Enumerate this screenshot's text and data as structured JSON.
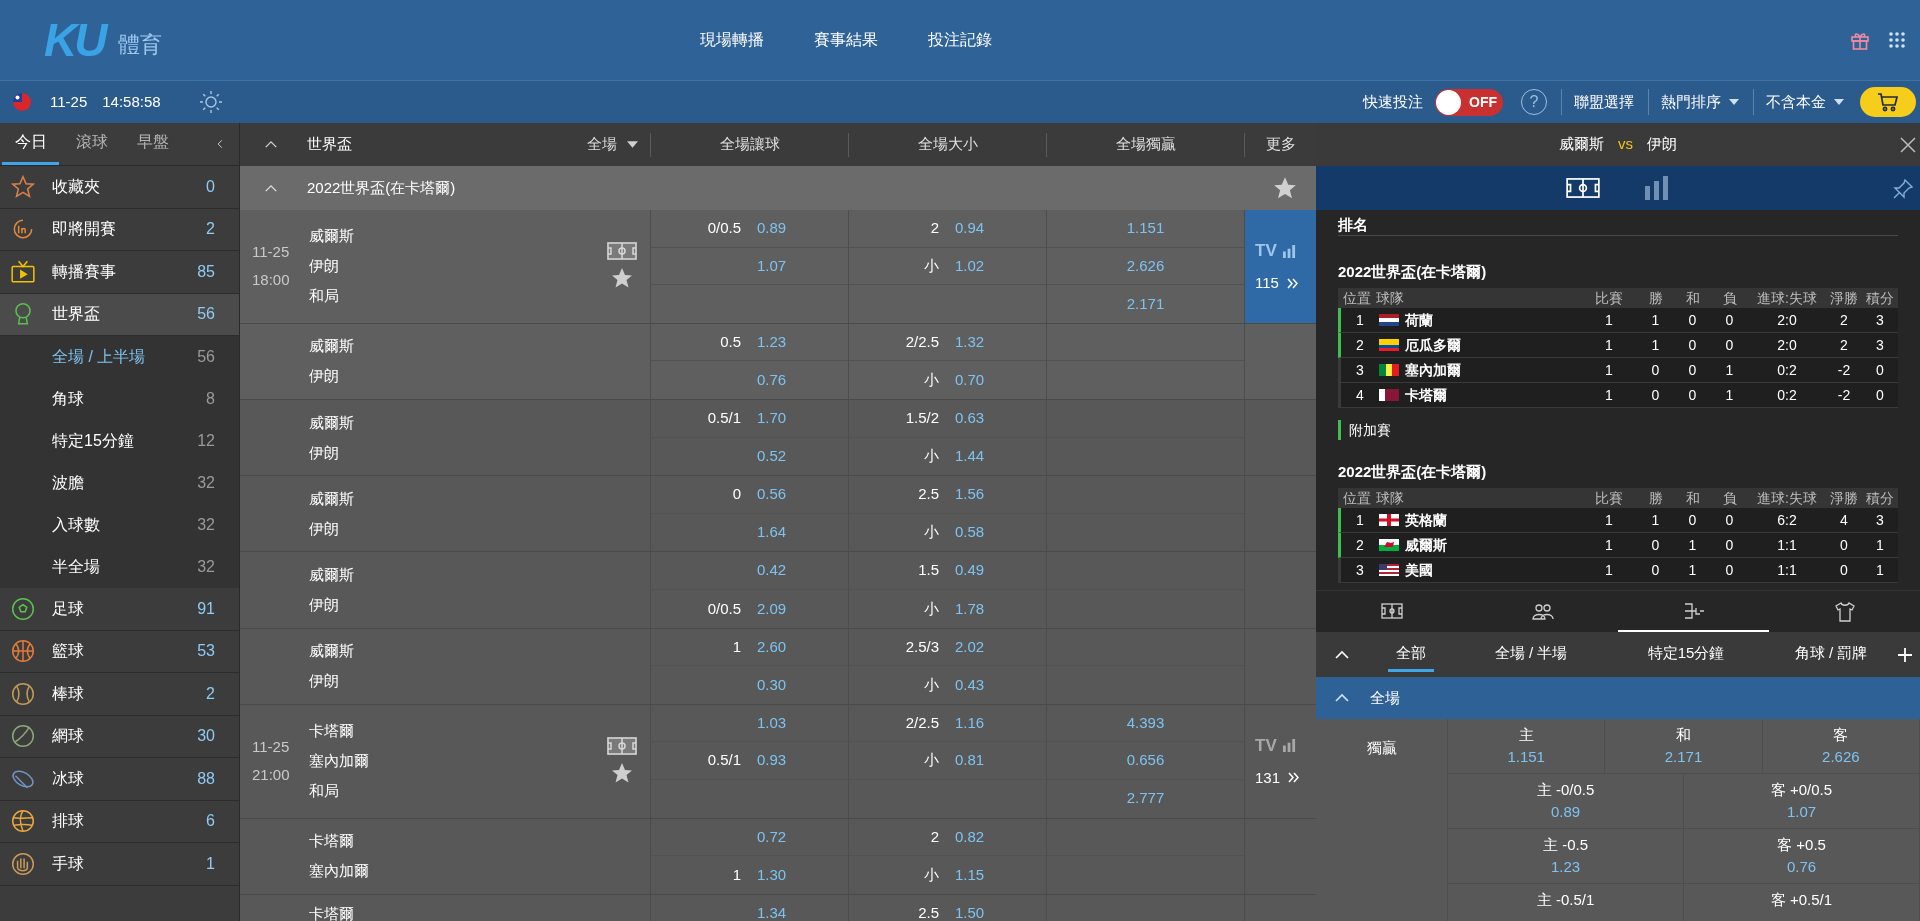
{
  "header": {
    "logo": {
      "mark": "KU",
      "text": "體育"
    },
    "nav": [
      {
        "label": "現場轉播"
      },
      {
        "label": "賽事結果"
      },
      {
        "label": "投注記錄"
      }
    ]
  },
  "subbar": {
    "date": "11-25",
    "time": "14:58:58",
    "quick_bet": {
      "label": "快速投注",
      "on": false,
      "toggle_text": "OFF"
    },
    "help": "?",
    "menus": [
      {
        "label": "聯盟選擇",
        "dropdown": false
      },
      {
        "label": "熱門排序",
        "dropdown": true
      },
      {
        "label": "不含本金",
        "dropdown": true
      }
    ]
  },
  "sidebar": {
    "tabs": [
      {
        "label": "今日",
        "selected": true
      },
      {
        "label": "滾球",
        "selected": false
      },
      {
        "label": "早盤",
        "selected": false
      }
    ],
    "items": [
      {
        "kind": "star",
        "label": "收藏夾",
        "count": "0",
        "expanded": false
      },
      {
        "kind": "soon",
        "label": "即將開賽",
        "count": "2",
        "expanded": false
      },
      {
        "kind": "tv",
        "label": "轉播賽事",
        "count": "85",
        "expanded": false
      },
      {
        "kind": "trophy",
        "label": "世界盃",
        "count": "56",
        "expanded": true,
        "children": [
          {
            "label": "全場 / 上半場",
            "count": "56",
            "selected": true
          },
          {
            "label": "角球",
            "count": "8",
            "selected": false
          },
          {
            "label": "特定15分鐘",
            "count": "12",
            "selected": false
          },
          {
            "label": "波膽",
            "count": "32",
            "selected": false
          },
          {
            "label": "入球數",
            "count": "32",
            "selected": false
          },
          {
            "label": "半全場",
            "count": "32",
            "selected": false
          }
        ]
      },
      {
        "kind": "soccer",
        "label": "足球",
        "count": "91",
        "expanded": false
      },
      {
        "kind": "basketball",
        "label": "籃球",
        "count": "53",
        "expanded": false
      },
      {
        "kind": "baseball",
        "label": "棒球",
        "count": "2",
        "expanded": false
      },
      {
        "kind": "tennis",
        "label": "網球",
        "count": "30",
        "expanded": false
      },
      {
        "kind": "hockey",
        "label": "冰球",
        "count": "88",
        "expanded": false
      },
      {
        "kind": "volleyball",
        "label": "排球",
        "count": "6",
        "expanded": false
      },
      {
        "kind": "handball",
        "label": "手球",
        "count": "1",
        "expanded": false
      }
    ]
  },
  "market": {
    "sport": "世界盃",
    "period": "全場",
    "columns": [
      "全場讓球",
      "全場大小",
      "全場獨贏",
      "更多"
    ],
    "league": {
      "name": "2022世界盃(在卡塔爾)",
      "expanded": true
    },
    "matches": [
      {
        "date": "11-25",
        "time": "18:00",
        "favorite": false,
        "teams": [
          "威爾斯",
          "伊朗",
          "和局"
        ],
        "lines": [
          {
            "hdp": "0/0.5",
            "hdp_odds": "0.89",
            "ou": "2",
            "ou_odds": "0.94",
            "win": "1.151"
          },
          {
            "hdp_odds": "1.07",
            "ou": "小",
            "ou_odds": "1.02",
            "win": "2.626"
          },
          {
            "win": "2.171"
          }
        ],
        "more": {
          "tv": "TV",
          "count": "115",
          "selected": true
        }
      },
      {
        "teams": [
          "威爾斯",
          "伊朗"
        ],
        "lines": [
          {
            "hdp": "0.5",
            "hdp_odds": "1.23",
            "ou": "2/2.5",
            "ou_odds": "1.32"
          },
          {
            "hdp_odds": "0.76",
            "ou": "小",
            "ou_odds": "0.70"
          }
        ]
      },
      {
        "teams": [
          "威爾斯",
          "伊朗"
        ],
        "lines": [
          {
            "hdp": "0.5/1",
            "hdp_odds": "1.70",
            "ou": "1.5/2",
            "ou_odds": "0.63"
          },
          {
            "hdp_odds": "0.52",
            "ou": "小",
            "ou_odds": "1.44"
          }
        ]
      },
      {
        "teams": [
          "威爾斯",
          "伊朗"
        ],
        "lines": [
          {
            "hdp": "0",
            "hdp_odds": "0.56",
            "ou": "2.5",
            "ou_odds": "1.56"
          },
          {
            "hdp_odds": "1.64",
            "ou": "小",
            "ou_odds": "0.58"
          }
        ]
      },
      {
        "teams": [
          "威爾斯",
          "伊朗"
        ],
        "lines": [
          {
            "hdp_odds": "0.42",
            "ou": "1.5",
            "ou_odds": "0.49"
          },
          {
            "hdp": "0/0.5",
            "hdp_odds": "2.09",
            "ou": "小",
            "ou_odds": "1.78"
          }
        ]
      },
      {
        "teams": [
          "威爾斯",
          "伊朗"
        ],
        "lines": [
          {
            "hdp": "1",
            "hdp_odds": "2.60",
            "ou": "2.5/3",
            "ou_odds": "2.02"
          },
          {
            "hdp_odds": "0.30",
            "ou": "小",
            "ou_odds": "0.43"
          }
        ]
      },
      {
        "date": "11-25",
        "time": "21:00",
        "favorite": false,
        "teams": [
          "卡塔爾",
          "塞內加爾",
          "和局"
        ],
        "lines": [
          {
            "hdp_odds": "1.03",
            "ou": "2/2.5",
            "ou_odds": "1.16",
            "win": "4.393"
          },
          {
            "hdp": "0.5/1",
            "hdp_odds": "0.93",
            "ou": "小",
            "ou_odds": "0.81",
            "win": "0.656"
          },
          {
            "win": "2.777"
          }
        ],
        "more": {
          "tv": "TV",
          "count": "131",
          "selected": false
        }
      },
      {
        "teams": [
          "卡塔爾",
          "塞內加爾"
        ],
        "lines": [
          {
            "hdp_odds": "0.72",
            "ou": "2",
            "ou_odds": "0.82"
          },
          {
            "hdp": "1",
            "hdp_odds": "1.30",
            "ou": "小",
            "ou_odds": "1.15"
          }
        ]
      },
      {
        "teams": [
          "卡塔爾"
        ],
        "lines": [
          {
            "hdp_odds": "1.34",
            "ou": "2.5",
            "ou_odds": "1.50"
          }
        ]
      }
    ]
  },
  "detail": {
    "home": "威爾斯",
    "vs": "vs",
    "away": "伊朗",
    "views": [
      {
        "kind": "pitch",
        "selected": true
      },
      {
        "kind": "stats",
        "selected": false
      }
    ],
    "standings_title": "排名",
    "sections": [
      {
        "kind": "table",
        "title": "2022世界盃(在卡塔爾)",
        "columns": [
          "位置",
          "球隊",
          "比賽",
          "勝",
          "和",
          "負",
          "進球:失球",
          "淨勝",
          "積分"
        ],
        "rows": [
          {
            "kind": "nl",
            "cells": [
              "1",
              "荷蘭",
              "1",
              "1",
              "0",
              "0",
              "2:0",
              "2",
              "3"
            ],
            "qualified": true
          },
          {
            "kind": "ec",
            "cells": [
              "2",
              "厄瓜多爾",
              "1",
              "1",
              "0",
              "0",
              "2:0",
              "2",
              "3"
            ],
            "qualified": true
          },
          {
            "kind": "sn",
            "cells": [
              "3",
              "塞內加爾",
              "1",
              "0",
              "0",
              "1",
              "0:2",
              "-2",
              "0"
            ],
            "qualified": false
          },
          {
            "kind": "qa",
            "cells": [
              "4",
              "卡塔爾",
              "1",
              "0",
              "0",
              "1",
              "0:2",
              "-2",
              "0"
            ],
            "qualified": false
          }
        ]
      },
      {
        "kind": "playoff",
        "label": "附加賽"
      },
      {
        "kind": "table",
        "title": "2022世界盃(在卡塔爾)",
        "columns": [
          "位置",
          "球隊",
          "比賽",
          "勝",
          "和",
          "負",
          "進球:失球",
          "淨勝",
          "積分"
        ],
        "rows": [
          {
            "kind": "en",
            "cells": [
              "1",
              "英格蘭",
              "1",
              "1",
              "0",
              "0",
              "6:2",
              "4",
              "3"
            ],
            "qualified": true
          },
          {
            "kind": "wa",
            "cells": [
              "2",
              "威爾斯",
              "1",
              "0",
              "1",
              "0",
              "1:1",
              "0",
              "1"
            ],
            "qualified": true
          },
          {
            "kind": "us",
            "cells": [
              "3",
              "美國",
              "1",
              "0",
              "1",
              "0",
              "1:1",
              "0",
              "1"
            ],
            "qualified": false
          }
        ]
      }
    ],
    "tabs": [
      {
        "kind": "pitch",
        "selected": false
      },
      {
        "kind": "people",
        "selected": false
      },
      {
        "kind": "lineup",
        "selected": true
      },
      {
        "kind": "shirt",
        "selected": false
      }
    ],
    "filters": [
      {
        "label": "全部",
        "selected": true
      },
      {
        "label": "全場 / 半場",
        "selected": false
      },
      {
        "label": "特定15分鐘",
        "selected": false
      },
      {
        "label": "角球 / 罰牌",
        "selected": false
      }
    ],
    "section": {
      "title": "全場",
      "expanded": true
    },
    "win": {
      "label": "獨贏",
      "options": [
        {
          "side": "主",
          "odds": "1.151"
        },
        {
          "side": "和",
          "odds": "2.171"
        },
        {
          "side": "客",
          "odds": "2.626"
        }
      ]
    },
    "handicap": [
      {
        "home": {
          "label": "主 -0/0.5",
          "odds": "0.89"
        },
        "away": {
          "label": "客 +0/0.5",
          "odds": "1.07"
        }
      },
      {
        "home": {
          "label": "主 -0.5",
          "odds": "1.23"
        },
        "away": {
          "label": "客 +0.5",
          "odds": "0.76"
        }
      },
      {
        "home": {
          "label": "主 -0.5/1"
        },
        "away": {
          "label": "客 +0.5/1"
        }
      }
    ]
  }
}
